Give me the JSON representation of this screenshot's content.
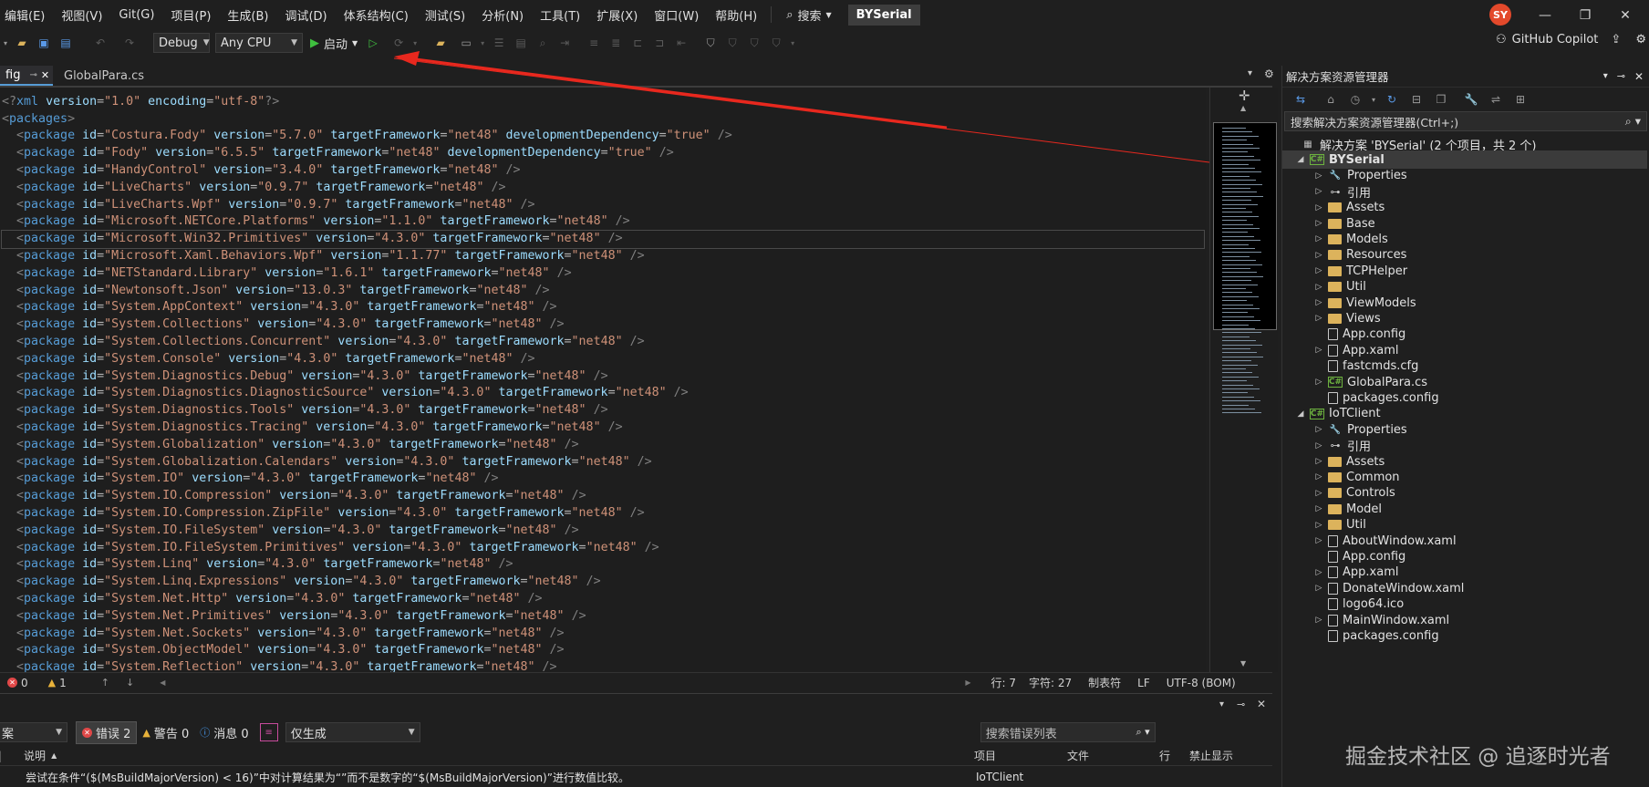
{
  "menu": [
    "编辑(E)",
    "视图(V)",
    "Git(G)",
    "项目(P)",
    "生成(B)",
    "调试(D)",
    "体系结构(C)",
    "测试(S)",
    "分析(N)",
    "工具(T)",
    "扩展(X)",
    "窗口(W)",
    "帮助(H)"
  ],
  "search_label": "搜索",
  "project_title": "BYSerial",
  "avatar_initials": "SY",
  "toolbar": {
    "config": "Debug",
    "platform": "Any CPU",
    "start_label": "启动"
  },
  "copilot_label": "GitHub Copilot",
  "tabs": {
    "active": "fig",
    "inactive": "GlobalPara.cs"
  },
  "editor": {
    "xml_decl": {
      "version": "1.0",
      "encoding": "utf-8"
    },
    "root": "packages",
    "packages": [
      {
        "id": "Costura.Fody",
        "version": "5.7.0",
        "tf": "net48",
        "dev": "true"
      },
      {
        "id": "Fody",
        "version": "6.5.5",
        "tf": "net48",
        "dev": "true"
      },
      {
        "id": "HandyControl",
        "version": "3.4.0",
        "tf": "net48"
      },
      {
        "id": "LiveCharts",
        "version": "0.9.7",
        "tf": "net48"
      },
      {
        "id": "LiveCharts.Wpf",
        "version": "0.9.7",
        "tf": "net48"
      },
      {
        "id": "Microsoft.NETCore.Platforms",
        "version": "1.1.0",
        "tf": "net48"
      },
      {
        "id": "Microsoft.Win32.Primitives",
        "version": "4.3.0",
        "tf": "net48"
      },
      {
        "id": "Microsoft.Xaml.Behaviors.Wpf",
        "version": "1.1.77",
        "tf": "net48"
      },
      {
        "id": "NETStandard.Library",
        "version": "1.6.1",
        "tf": "net48"
      },
      {
        "id": "Newtonsoft.Json",
        "version": "13.0.3",
        "tf": "net48"
      },
      {
        "id": "System.AppContext",
        "version": "4.3.0",
        "tf": "net48"
      },
      {
        "id": "System.Collections",
        "version": "4.3.0",
        "tf": "net48"
      },
      {
        "id": "System.Collections.Concurrent",
        "version": "4.3.0",
        "tf": "net48"
      },
      {
        "id": "System.Console",
        "version": "4.3.0",
        "tf": "net48"
      },
      {
        "id": "System.Diagnostics.Debug",
        "version": "4.3.0",
        "tf": "net48"
      },
      {
        "id": "System.Diagnostics.DiagnosticSource",
        "version": "4.3.0",
        "tf": "net48"
      },
      {
        "id": "System.Diagnostics.Tools",
        "version": "4.3.0",
        "tf": "net48"
      },
      {
        "id": "System.Diagnostics.Tracing",
        "version": "4.3.0",
        "tf": "net48"
      },
      {
        "id": "System.Globalization",
        "version": "4.3.0",
        "tf": "net48"
      },
      {
        "id": "System.Globalization.Calendars",
        "version": "4.3.0",
        "tf": "net48"
      },
      {
        "id": "System.IO",
        "version": "4.3.0",
        "tf": "net48"
      },
      {
        "id": "System.IO.Compression",
        "version": "4.3.0",
        "tf": "net48"
      },
      {
        "id": "System.IO.Compression.ZipFile",
        "version": "4.3.0",
        "tf": "net48"
      },
      {
        "id": "System.IO.FileSystem",
        "version": "4.3.0",
        "tf": "net48"
      },
      {
        "id": "System.IO.FileSystem.Primitives",
        "version": "4.3.0",
        "tf": "net48"
      },
      {
        "id": "System.Linq",
        "version": "4.3.0",
        "tf": "net48"
      },
      {
        "id": "System.Linq.Expressions",
        "version": "4.3.0",
        "tf": "net48"
      },
      {
        "id": "System.Net.Http",
        "version": "4.3.0",
        "tf": "net48"
      },
      {
        "id": "System.Net.Primitives",
        "version": "4.3.0",
        "tf": "net48"
      },
      {
        "id": "System.Net.Sockets",
        "version": "4.3.0",
        "tf": "net48"
      },
      {
        "id": "System.ObjectModel",
        "version": "4.3.0",
        "tf": "net48"
      },
      {
        "id": "System.Reflection",
        "version": "4.3.0",
        "tf": "net48"
      }
    ],
    "current_line_index": 6
  },
  "status": {
    "errors": "0",
    "warnings": "1",
    "line": "行: 7",
    "col": "字符: 27",
    "tabs": "制表符",
    "eol": "LF",
    "encoding": "UTF-8 (BOM)"
  },
  "error_list": {
    "scope_label": "案",
    "errors_chip": "错误 2",
    "warnings_chip": "警告 0",
    "messages_chip": "消息 0",
    "filter": "仅生成",
    "search_placeholder": "搜索错误列表",
    "headers": {
      "desc": "说明",
      "project": "项目",
      "file": "文件",
      "line": "行",
      "suppress": "禁止显示"
    },
    "row": {
      "desc": "尝试在条件“($(MsBuildMajorVersion) < 16)”中对计算结果为“”而不是数字的“$(MsBuildMajorVersion)”进行数值比较。",
      "project": "IoTClient"
    }
  },
  "solution_explorer": {
    "title": "解决方案资源管理器",
    "search_placeholder": "搜索解决方案资源管理器(Ctrl+;)",
    "items": [
      {
        "label": "解决方案 'BYSerial' (2 个项目，共 2 个)",
        "depth": 0,
        "icon": "solution-icon",
        "twisty": ""
      },
      {
        "label": "BYSerial",
        "depth": 0,
        "icon": "csproj-icon",
        "twisty": "◢",
        "bold": true,
        "selected": true
      },
      {
        "label": "Properties",
        "depth": 1,
        "icon": "wrench-icon",
        "twisty": "▷"
      },
      {
        "label": "引用",
        "depth": 1,
        "icon": "references-icon",
        "twisty": "▷"
      },
      {
        "label": "Assets",
        "depth": 1,
        "icon": "folder-icon",
        "twisty": "▷"
      },
      {
        "label": "Base",
        "depth": 1,
        "icon": "folder-icon",
        "twisty": "▷"
      },
      {
        "label": "Models",
        "depth": 1,
        "icon": "folder-icon",
        "twisty": "▷"
      },
      {
        "label": "Resources",
        "depth": 1,
        "icon": "folder-icon",
        "twisty": "▷"
      },
      {
        "label": "TCPHelper",
        "depth": 1,
        "icon": "folder-icon",
        "twisty": "▷"
      },
      {
        "label": "Util",
        "depth": 1,
        "icon": "folder-icon",
        "twisty": "▷"
      },
      {
        "label": "ViewModels",
        "depth": 1,
        "icon": "folder-icon",
        "twisty": "▷"
      },
      {
        "label": "Views",
        "depth": 1,
        "icon": "folder-icon",
        "twisty": "▷"
      },
      {
        "label": "App.config",
        "depth": 1,
        "icon": "config-file-icon",
        "twisty": ""
      },
      {
        "label": "App.xaml",
        "depth": 1,
        "icon": "xaml-file-icon",
        "twisty": "▷"
      },
      {
        "label": "fastcmds.cfg",
        "depth": 1,
        "icon": "file-icon",
        "twisty": ""
      },
      {
        "label": "GlobalPara.cs",
        "depth": 1,
        "icon": "csharp-file-icon",
        "twisty": "▷"
      },
      {
        "label": "packages.config",
        "depth": 1,
        "icon": "config-file-icon",
        "twisty": ""
      },
      {
        "label": "IoTClient",
        "depth": 0,
        "icon": "csproj-icon",
        "twisty": "◢"
      },
      {
        "label": "Properties",
        "depth": 1,
        "icon": "wrench-icon",
        "twisty": "▷"
      },
      {
        "label": "引用",
        "depth": 1,
        "icon": "references-icon",
        "twisty": "▷"
      },
      {
        "label": "Assets",
        "depth": 1,
        "icon": "folder-icon",
        "twisty": "▷"
      },
      {
        "label": "Common",
        "depth": 1,
        "icon": "folder-icon",
        "twisty": "▷"
      },
      {
        "label": "Controls",
        "depth": 1,
        "icon": "folder-icon",
        "twisty": "▷"
      },
      {
        "label": "Model",
        "depth": 1,
        "icon": "folder-icon",
        "twisty": "▷"
      },
      {
        "label": "Util",
        "depth": 1,
        "icon": "folder-icon",
        "twisty": "▷"
      },
      {
        "label": "AboutWindow.xaml",
        "depth": 1,
        "icon": "xaml-file-icon",
        "twisty": "▷"
      },
      {
        "label": "App.config",
        "depth": 1,
        "icon": "config-file-icon",
        "twisty": ""
      },
      {
        "label": "App.xaml",
        "depth": 1,
        "icon": "xaml-file-icon",
        "twisty": "▷"
      },
      {
        "label": "DonateWindow.xaml",
        "depth": 1,
        "icon": "xaml-file-icon",
        "twisty": "▷"
      },
      {
        "label": "logo64.ico",
        "depth": 1,
        "icon": "file-icon",
        "twisty": ""
      },
      {
        "label": "MainWindow.xaml",
        "depth": 1,
        "icon": "xaml-file-icon",
        "twisty": "▷"
      },
      {
        "label": "packages.config",
        "depth": 1,
        "icon": "config-file-icon",
        "twisty": ""
      }
    ]
  },
  "watermark": "掘金技术社区 @ 追逐时光者",
  "colors": {
    "background": "#1f1f1f",
    "editor_bg": "#1e1e1e",
    "annotation_arrow": "#e8281e",
    "xml_tag": "#569cd6",
    "xml_attr": "#9cdcfe",
    "xml_value": "#ce9178",
    "accent_green": "#3fbf3f"
  }
}
